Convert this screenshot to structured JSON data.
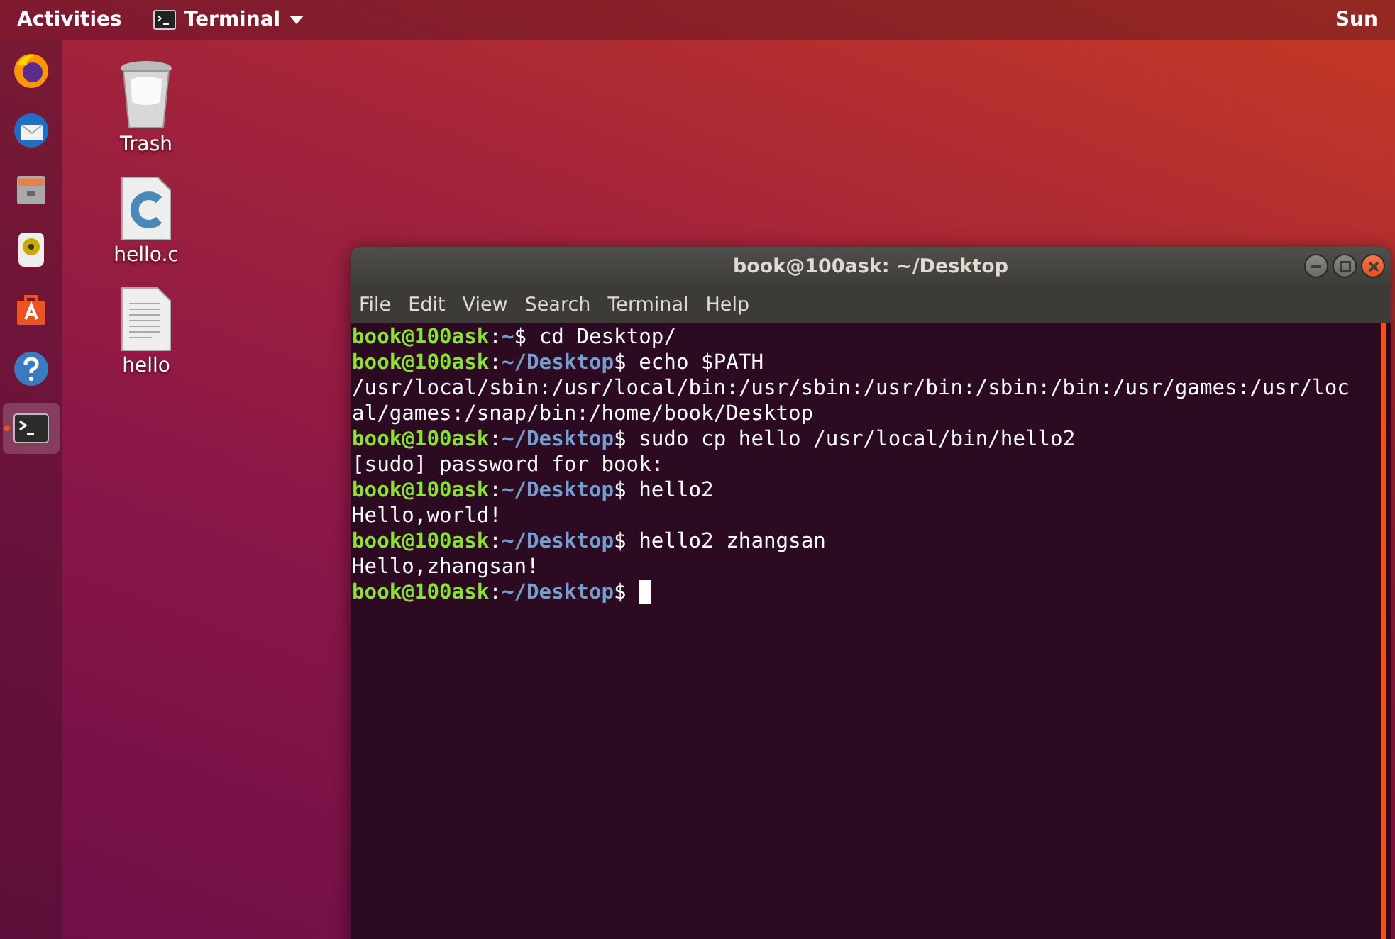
{
  "top_bar": {
    "activities": "Activities",
    "app_menu": "Terminal",
    "clock": "Sun"
  },
  "dock": [
    {
      "kind": "browser",
      "selected": false,
      "running": false
    },
    {
      "kind": "mail",
      "selected": false,
      "running": false
    },
    {
      "kind": "files",
      "selected": false,
      "running": false
    },
    {
      "kind": "music",
      "selected": false,
      "running": false
    },
    {
      "kind": "store",
      "selected": false,
      "running": false
    },
    {
      "kind": "help",
      "selected": false,
      "running": false
    },
    {
      "kind": "terminal",
      "selected": true,
      "running": true
    }
  ],
  "desktop_icons": [
    {
      "kind": "trash",
      "label": "Trash"
    },
    {
      "kind": "source",
      "label": "hello.c"
    },
    {
      "kind": "document",
      "label": "hello"
    }
  ],
  "window": {
    "title": "book@100ask: ~/Desktop",
    "menu": [
      "File",
      "Edit",
      "View",
      "Search",
      "Terminal",
      "Help"
    ],
    "lines": [
      {
        "kind": "prompt",
        "user": "book@100ask",
        "colon": ":",
        "path": "~",
        "sign": "$",
        "command": " cd Desktop/",
        "cursor": false
      },
      {
        "kind": "prompt",
        "user": "book@100ask",
        "colon": ":",
        "path": "~/Desktop",
        "sign": "$",
        "command": " echo $PATH",
        "cursor": false
      },
      {
        "kind": "output",
        "text": "/usr/local/sbin:/usr/local/bin:/usr/sbin:/usr/bin:/sbin:/bin:/usr/games:/usr/loc"
      },
      {
        "kind": "output",
        "text": "al/games:/snap/bin:/home/book/Desktop"
      },
      {
        "kind": "prompt",
        "user": "book@100ask",
        "colon": ":",
        "path": "~/Desktop",
        "sign": "$",
        "command": " sudo cp hello /usr/local/bin/hello2",
        "cursor": false
      },
      {
        "kind": "output",
        "text": "[sudo] password for book:"
      },
      {
        "kind": "prompt",
        "user": "book@100ask",
        "colon": ":",
        "path": "~/Desktop",
        "sign": "$",
        "command": " hello2",
        "cursor": false
      },
      {
        "kind": "output",
        "text": "Hello,world!"
      },
      {
        "kind": "prompt",
        "user": "book@100ask",
        "colon": ":",
        "path": "~/Desktop",
        "sign": "$",
        "command": " hello2 zhangsan",
        "cursor": false
      },
      {
        "kind": "output",
        "text": "Hello,zhangsan!"
      },
      {
        "kind": "prompt",
        "user": "book@100ask",
        "colon": ":",
        "path": "~/Desktop",
        "sign": "$",
        "cursor": true
      }
    ]
  }
}
